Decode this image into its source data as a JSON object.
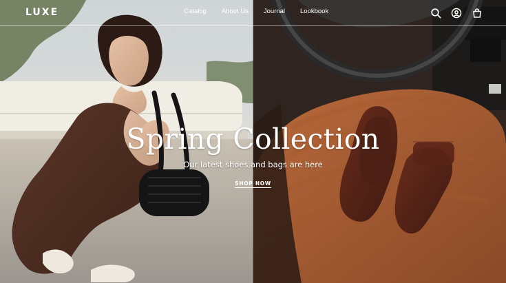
{
  "header": {
    "logo": "LUXE",
    "nav": [
      {
        "label": "Catalog"
      },
      {
        "label": "About Us"
      },
      {
        "label": "Journal"
      },
      {
        "label": "Lookbook"
      }
    ],
    "icons": [
      "search-icon",
      "account-icon",
      "bag-icon"
    ]
  },
  "hero": {
    "title": "Spring Collection",
    "subtitle": "Our latest shoes and bags are here",
    "cta": "SHOP NOW"
  },
  "colors": {
    "text": "#ffffff"
  }
}
